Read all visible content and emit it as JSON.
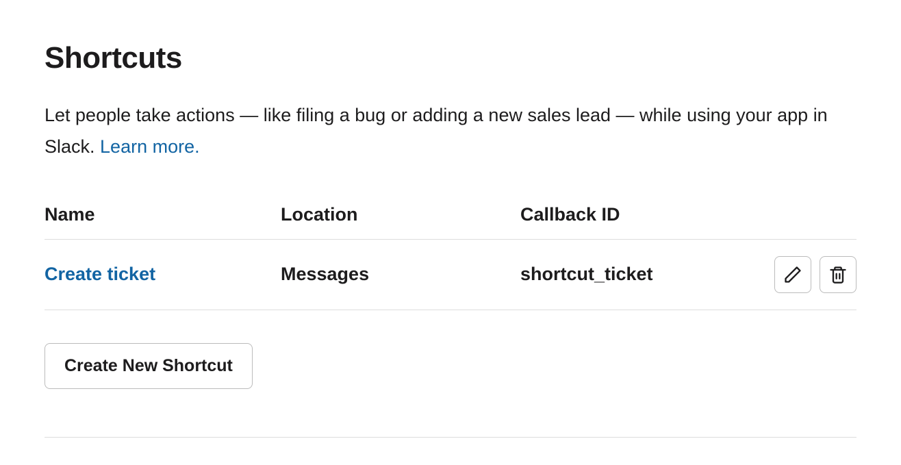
{
  "page": {
    "title": "Shortcuts",
    "description_pre": "Let people take actions — like filing a bug or adding a new sales lead — while using your app in Slack. ",
    "learn_more": "Learn more."
  },
  "table": {
    "headers": {
      "name": "Name",
      "location": "Location",
      "callback": "Callback ID"
    },
    "rows": [
      {
        "name": "Create ticket",
        "location": "Messages",
        "callback": "shortcut_ticket"
      }
    ]
  },
  "buttons": {
    "create_new": "Create New Shortcut"
  }
}
